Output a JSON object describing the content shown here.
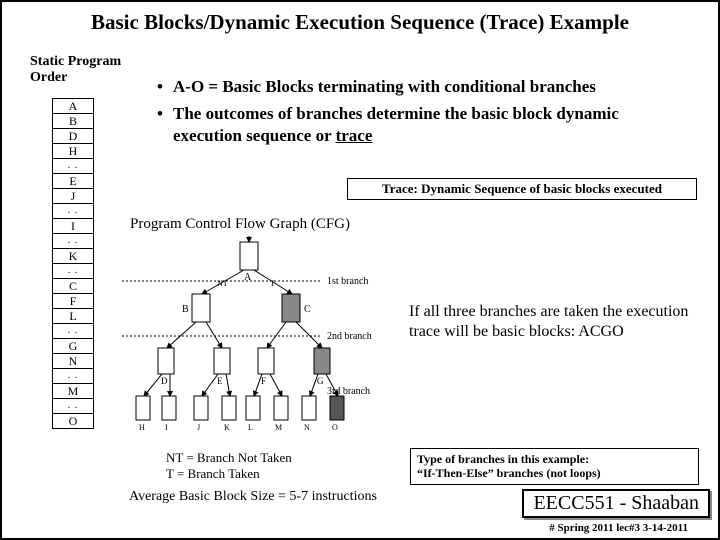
{
  "title": "Basic Blocks/Dynamic Execution Sequence (Trace) Example",
  "static_label_l1": "Static Program",
  "static_label_l2": "Order",
  "blocks": [
    "A",
    "B",
    "D",
    "H",
    ". .",
    "E",
    "J",
    ". .",
    "I",
    ". .",
    "K",
    ". .",
    "C",
    "F",
    "L",
    ". .",
    "G",
    "N",
    ". .",
    "M",
    ". .",
    "O"
  ],
  "bullet1": "A-O = Basic Blocks terminating with conditional branches",
  "bullet2_pre": "The outcomes of branches determine the basic block dynamic execution sequence or ",
  "bullet2_u": "trace",
  "trace_box": "Trace:  Dynamic Sequence of basic blocks executed",
  "cfg_label": "Program Control Flow Graph (CFG)",
  "cfg": {
    "nodes": [
      "A",
      "B",
      "C",
      "D",
      "E",
      "F",
      "G",
      "H",
      "I",
      "J",
      "K",
      "L",
      "M",
      "N",
      "O"
    ],
    "branch_labels": {
      "b1": "1st branch",
      "b2": "2nd branch",
      "b3": "3rd branch"
    },
    "edge_nt": "NT",
    "edge_t": "T"
  },
  "right_text": "If all three branches are taken the execution trace will be basic blocks:   ACGO",
  "legend_nt": "NT =  Branch Not Taken",
  "legend_t": "T    =  Branch Taken",
  "type_box_l1": "Type of branches in this example:",
  "type_box_l2": "“If-Then-Else” branches (not loops)",
  "avg_line": "Average Basic Block Size = 5-7 instructions",
  "footer": "EECC551 - Shaaban",
  "footer_date": "#  Spring 2011  lec#3   3-14-2011"
}
